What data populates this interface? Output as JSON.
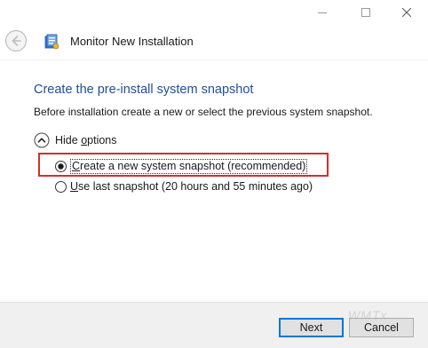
{
  "window": {
    "title": "Monitor New Installation",
    "controls": {
      "minimize_icon": "minimize-icon",
      "maximize_icon": "maximize-icon",
      "close_icon": "close-icon"
    }
  },
  "page": {
    "heading": "Create the pre-install system snapshot",
    "description": "Before installation create a new or select the previous system snapshot.",
    "toggle": {
      "prefix": "Hide ",
      "accesskey": "o",
      "suffix": "ptions",
      "expanded": true
    },
    "options": [
      {
        "prefix": "",
        "accesskey": "C",
        "suffix": "reate a new system snapshot (recommended)",
        "selected": true
      },
      {
        "prefix": "",
        "accesskey": "U",
        "suffix": "se last snapshot (20 hours and 55 minutes ago)",
        "selected": false
      }
    ]
  },
  "footer": {
    "next_label": "Next",
    "cancel_label": "Cancel"
  },
  "watermark": "WMTx",
  "colors": {
    "heading": "#1f4fa0",
    "highlight": "#d32f2f",
    "default_button_border": "#0078d7",
    "footer_bg": "#f0f0f0"
  }
}
